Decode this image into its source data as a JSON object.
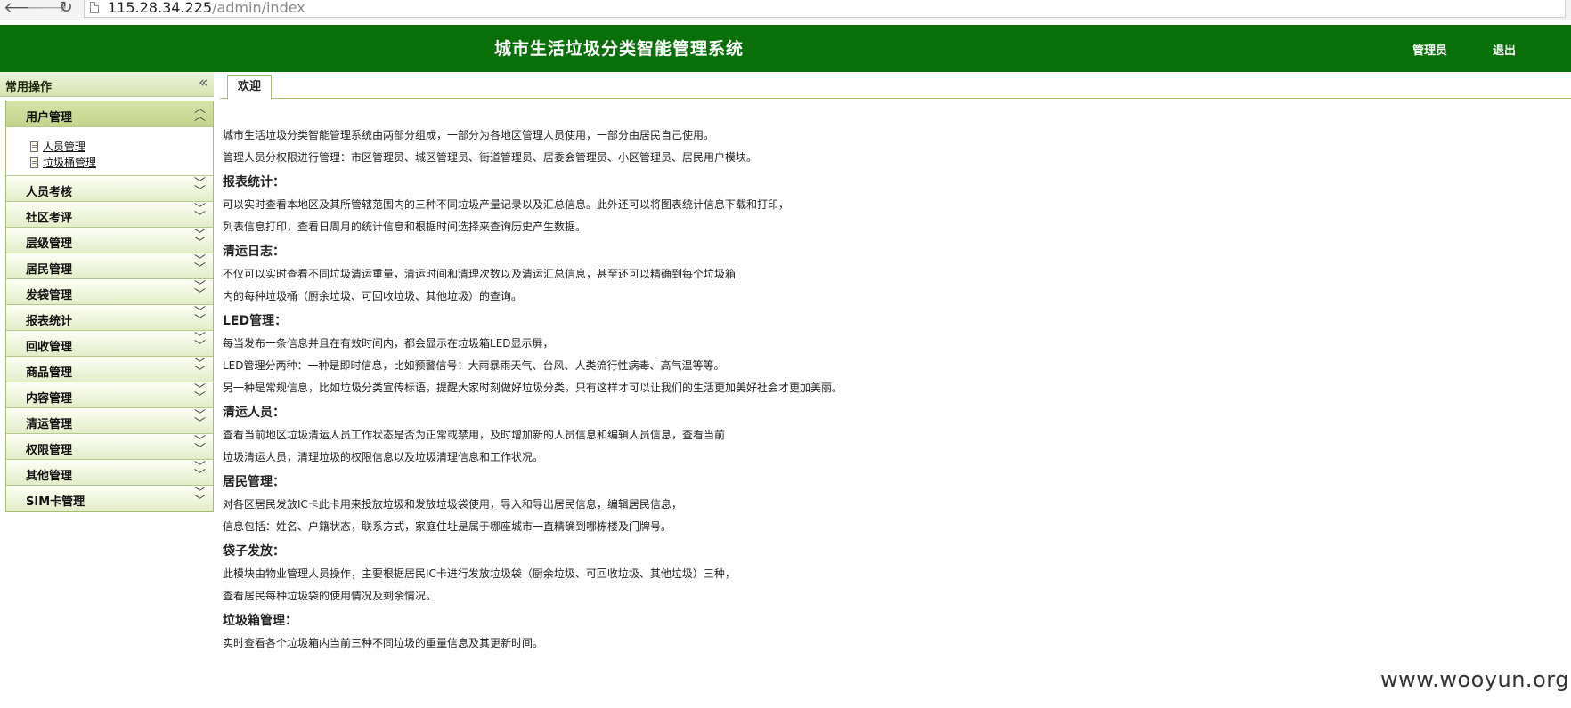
{
  "browser": {
    "url_host": "115.28.34.225",
    "url_path": "/admin/index"
  },
  "header": {
    "title": "城市生活垃圾分类智能管理系统",
    "admin_label": "管理员",
    "logout_label": "退出"
  },
  "sidebar": {
    "title": "常用操作",
    "sections": [
      {
        "label": "用户管理",
        "expanded": true,
        "items": [
          "人员管理",
          "垃圾桶管理"
        ]
      },
      {
        "label": "人员考核"
      },
      {
        "label": "社区考评"
      },
      {
        "label": "层级管理"
      },
      {
        "label": "居民管理"
      },
      {
        "label": "发袋管理"
      },
      {
        "label": "报表统计"
      },
      {
        "label": "回收管理"
      },
      {
        "label": "商品管理"
      },
      {
        "label": "内容管理"
      },
      {
        "label": "清运管理"
      },
      {
        "label": "权限管理"
      },
      {
        "label": "其他管理"
      },
      {
        "label": "SIM卡管理"
      }
    ]
  },
  "tabs": [
    {
      "label": "欢迎"
    }
  ],
  "content": {
    "blocks": [
      {
        "type": "p",
        "text": "城市生活垃圾分类智能管理系统由两部分组成，一部分为各地区管理人员使用，一部分由居民自己使用。"
      },
      {
        "type": "p",
        "text": "管理人员分权限进行管理：市区管理员、城区管理员、街道管理员、居委会管理员、小区管理员、居民用户模块。"
      },
      {
        "type": "h",
        "text": "报表统计："
      },
      {
        "type": "p",
        "text": "可以实时查看本地区及其所管辖范围内的三种不同垃圾产量记录以及汇总信息。此外还可以将图表统计信息下载和打印，"
      },
      {
        "type": "p",
        "text": "列表信息打印，查看日周月的统计信息和根据时间选择来查询历史产生数据。"
      },
      {
        "type": "h",
        "text": "清运日志："
      },
      {
        "type": "p",
        "text": "不仅可以实时查看不同垃圾清运重量，清运时间和清理次数以及清运汇总信息，甚至还可以精确到每个垃圾箱"
      },
      {
        "type": "p",
        "text": "内的每种垃圾桶（厨余垃圾、可回收垃圾、其他垃圾）的查询。"
      },
      {
        "type": "h",
        "text": "LED管理："
      },
      {
        "type": "p",
        "text": "每当发布一条信息并且在有效时间内，都会显示在垃圾箱LED显示屏，"
      },
      {
        "type": "p",
        "text": "LED管理分两种：一种是即时信息，比如预警信号：大雨暴雨天气、台风、人类流行性病毒、高气温等等。"
      },
      {
        "type": "p",
        "text": "另一种是常规信息，比如垃圾分类宣传标语，提醒大家时刻做好垃圾分类，只有这样才可以让我们的生活更加美好社会才更加美丽。"
      },
      {
        "type": "h",
        "text": "清运人员："
      },
      {
        "type": "p",
        "text": "查看当前地区垃圾清运人员工作状态是否为正常或禁用，及时增加新的人员信息和编辑人员信息，查看当前"
      },
      {
        "type": "p",
        "text": "垃圾清运人员，清理垃圾的权限信息以及垃圾清理信息和工作状况。"
      },
      {
        "type": "h",
        "text": "居民管理："
      },
      {
        "type": "p",
        "text": "对各区居民发放IC卡此卡用来投放垃圾和发放垃圾袋使用，导入和导出居民信息，编辑居民信息，"
      },
      {
        "type": "p",
        "text": "信息包括：姓名、户籍状态，联系方式，家庭住址是属于哪座城市一直精确到哪栋楼及门牌号。"
      },
      {
        "type": "h",
        "text": "袋子发放："
      },
      {
        "type": "p",
        "text": "此模块由物业管理人员操作，主要根据居民IC卡进行发放垃圾袋（厨余垃圾、可回收垃圾、其他垃圾）三种，"
      },
      {
        "type": "p",
        "text": "查看居民每种垃圾袋的使用情况及剩余情况。"
      },
      {
        "type": "h",
        "text": "垃圾箱管理："
      },
      {
        "type": "p",
        "text": "实时查看各个垃圾箱内当前三种不同垃圾的重量信息及其更新时间。"
      }
    ]
  },
  "watermark": "www.wooyun.org"
}
